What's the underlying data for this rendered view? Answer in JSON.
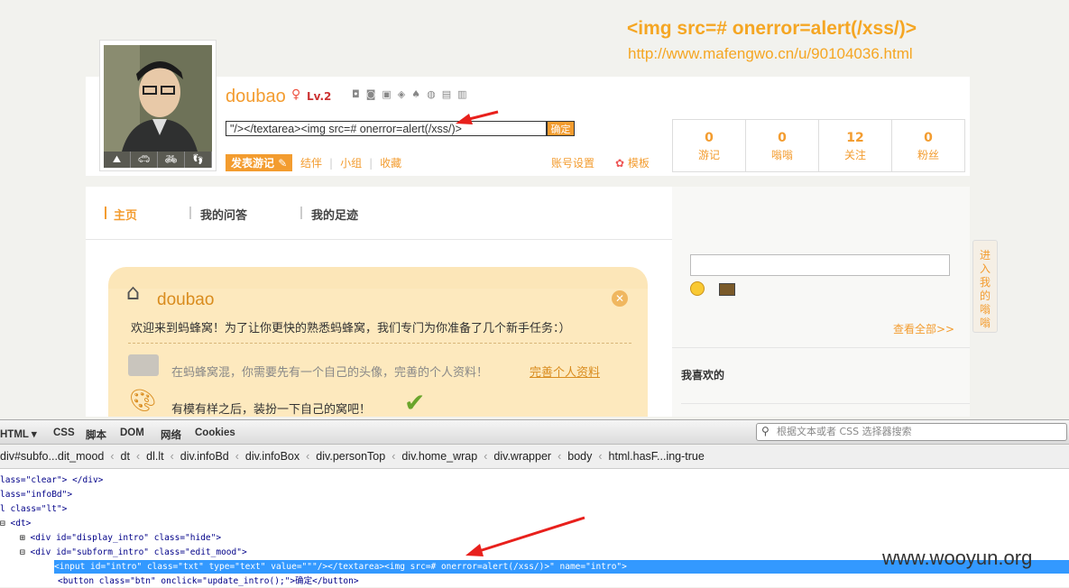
{
  "annotation": {
    "payload": "<img src=# onerror=alert(/xss/)>",
    "url": "http://www.mafengwo.cn/u/90104036.html"
  },
  "profile": {
    "username": "doubao",
    "gender_icon": "♀",
    "level": "Lv.2",
    "badge_icons": [
      "camera-icon",
      "car-icon",
      "bus-icon",
      "cat-icon",
      "spade-icon",
      "ball-icon",
      "bag-icon",
      "book-icon"
    ],
    "avatar_icons": [
      "mountain-icon",
      "car-icon",
      "bike-icon",
      "footprint-icon"
    ],
    "intro_value": "\"/></textarea><img src=# onerror=alert(/xss/)>",
    "intro_button": "确定",
    "post_button": "发表游记",
    "links": [
      "结伴",
      "小组",
      "收藏"
    ],
    "account_settings": "账号设置",
    "template": "模板",
    "stats": [
      {
        "value": "0",
        "label": "游记"
      },
      {
        "value": "0",
        "label": "嗡嗡"
      },
      {
        "value": "12",
        "label": "关注"
      },
      {
        "value": "0",
        "label": "粉丝"
      }
    ]
  },
  "nav": {
    "tabs": [
      "主页",
      "我的问答",
      "我的足迹"
    ]
  },
  "welcome": {
    "name": "doubao",
    "message": "欢迎来到蚂蜂窝！为了让你更快的熟悉蚂蜂窝，我们专门为你准备了几个新手任务：）",
    "task1": "在蚂蜂窝混，你需要先有一个自己的头像，完善的个人资料！",
    "task1_link": "完善个人资料",
    "task2": "有模有样之后，装扮一下自己的窝吧！"
  },
  "right": {
    "see_all": "查看全部>>",
    "likes": "我喜欢的",
    "side_tab": "进入我的嗡嗡"
  },
  "firebug": {
    "tabs": [
      "HTML ▾",
      "CSS",
      "脚本",
      "DOM",
      "网络",
      "Cookies"
    ],
    "search_placeholder": "根据文本或者 CSS 选择器搜索",
    "breadcrumbs": [
      "div#subfo...dit_mood",
      "dt",
      "dl.lt",
      "div.infoBd",
      "div.infoBox",
      "div.personTop",
      "div.home_wrap",
      "div.wrapper",
      "body",
      "html.hasF...ing-true"
    ],
    "code": [
      "lass=\"clear\"> </div>",
      "lass=\"infoBd\">",
      "l class=\"lt\">",
      "<dt>",
      "<div id=\"display_intro\" class=\"hide\">",
      "<div id=\"subform_intro\" class=\"edit_mood\">",
      "<input id=\"intro\" class=\"txt\" type=\"text\" value=\"\"\"/></textarea><img src=# onerror=alert(/xss/)>\" name=\"intro\">",
      "<button class=\"btn\" onclick=\"update_intro();\">确定</button>"
    ]
  },
  "watermark": "www.wooyun.org"
}
